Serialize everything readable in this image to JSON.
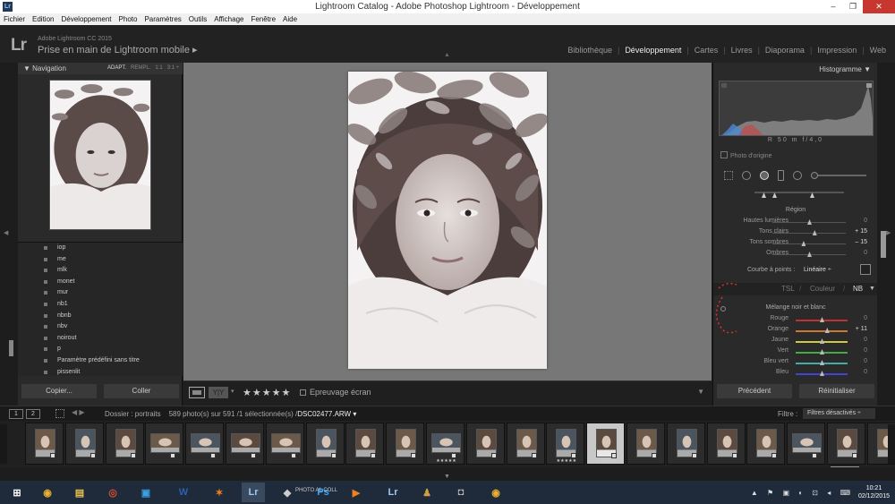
{
  "window": {
    "title": "Lightroom Catalog - Adobe Photoshop Lightroom - Développement",
    "app_icon": "Lr",
    "controls": [
      "–",
      "❐",
      "✕"
    ]
  },
  "menu": [
    "Fichier",
    "Edition",
    "Développement",
    "Photo",
    "Paramètres",
    "Outils",
    "Affichage",
    "Fenêtre",
    "Aide"
  ],
  "identity": {
    "logo": "Lr",
    "subtitle": "Adobe Lightroom CC 2015",
    "title": "Prise en main de Lightroom mobile",
    "title_arrow": "▸"
  },
  "modules": [
    {
      "label": "Bibliothèque",
      "active": false
    },
    {
      "label": "Développement",
      "active": true
    },
    {
      "label": "Cartes",
      "active": false
    },
    {
      "label": "Livres",
      "active": false
    },
    {
      "label": "Diaporama",
      "active": false
    },
    {
      "label": "Impression",
      "active": false
    },
    {
      "label": "Web",
      "active": false
    }
  ],
  "navigator": {
    "title": "Navigation",
    "modes": [
      "ADAPT.",
      "REMPL.",
      "1:1",
      "3:1 ÷"
    ]
  },
  "presets": [
    "iop",
    "me",
    "mlk",
    "monet",
    "mur",
    "nb1",
    "nbnb",
    "nbv",
    "noirout",
    "p",
    "Paramètre prédéfini sans titre",
    "pissenlit"
  ],
  "left_buttons": {
    "copy": "Copier...",
    "paste": "Coller"
  },
  "toolbar": {
    "yy": "Y|Y",
    "stars": "★★★★★",
    "softproof": "Epreuvage écran"
  },
  "histogram": {
    "title": "Histogramme",
    "info": "R 50 m f/4,0",
    "original": "Photo d'origine",
    "colors": {
      "blue": "#4a8ad6",
      "red": "#d04040",
      "gray": "#9a9a9a"
    }
  },
  "region": {
    "title": "Région",
    "sliders": [
      {
        "label": "Hautes lumières",
        "value": "0",
        "pos": 0.5
      },
      {
        "label": "Tons clairs",
        "value": "+ 15",
        "pos": 0.57
      },
      {
        "label": "Tons sombres",
        "value": "– 15",
        "pos": 0.42
      },
      {
        "label": "Ombres",
        "value": "0",
        "pos": 0.5
      }
    ]
  },
  "curve": {
    "label": "Courbe à points :",
    "value": "Linéaire ÷"
  },
  "hsl": {
    "tsl": "TSL",
    "sep1": "/",
    "couleur": "Couleur",
    "sep2": "/",
    "nb": "NB",
    "arrow": "▼"
  },
  "bw_mix": {
    "title": "Mélange noir et blanc",
    "sliders": [
      {
        "label": "Rouge",
        "value": "0",
        "pos": 0.5,
        "color": "#b33"
      },
      {
        "label": "Orange",
        "value": "+ 11",
        "pos": 0.6,
        "color": "#c73"
      },
      {
        "label": "Jaune",
        "value": "0",
        "pos": 0.5,
        "color": "#cc4"
      },
      {
        "label": "Vert",
        "value": "0",
        "pos": 0.5,
        "color": "#4a4"
      },
      {
        "label": "Bleu vert",
        "value": "0",
        "pos": 0.5,
        "color": "#4aa"
      },
      {
        "label": "Bleu",
        "value": "0",
        "pos": 0.5,
        "color": "#44c"
      }
    ]
  },
  "right_buttons": {
    "previous": "Précédent",
    "reset": "Réinitialiser"
  },
  "filmbar": {
    "pages": [
      "1",
      "2"
    ],
    "nav": "◀ ▶",
    "source_prefix": "Dossier : portraits",
    "count": "589 photo(s) sur 591 /1 sélectionnée(s) /",
    "file": "DSC02477.ARW ▾",
    "filter_label": "Filtre :",
    "filter_value": "Filtres désactivés ÷"
  },
  "filmstrip": [
    {
      "orient": "p",
      "sel": false,
      "stars": ""
    },
    {
      "orient": "p",
      "sel": false,
      "stars": ""
    },
    {
      "orient": "p",
      "sel": false,
      "stars": ""
    },
    {
      "orient": "l",
      "sel": false,
      "stars": ""
    },
    {
      "orient": "l",
      "sel": false,
      "stars": ""
    },
    {
      "orient": "l",
      "sel": false,
      "stars": ""
    },
    {
      "orient": "l",
      "sel": false,
      "stars": ""
    },
    {
      "orient": "p",
      "sel": false,
      "stars": ""
    },
    {
      "orient": "p",
      "sel": false,
      "stars": ""
    },
    {
      "orient": "p",
      "sel": false,
      "stars": ""
    },
    {
      "orient": "l",
      "sel": false,
      "stars": "★★★★★"
    },
    {
      "orient": "p",
      "sel": false,
      "stars": ""
    },
    {
      "orient": "p",
      "sel": false,
      "stars": ""
    },
    {
      "orient": "p",
      "sel": false,
      "stars": "★★★★★"
    },
    {
      "orient": "p",
      "sel": true,
      "stars": "★★★★★"
    },
    {
      "orient": "p",
      "sel": false,
      "stars": ""
    },
    {
      "orient": "p",
      "sel": false,
      "stars": ""
    },
    {
      "orient": "p",
      "sel": false,
      "stars": ""
    },
    {
      "orient": "p",
      "sel": false,
      "stars": ""
    },
    {
      "orient": "l",
      "sel": false,
      "stars": ""
    },
    {
      "orient": "p",
      "sel": false,
      "stars": ""
    },
    {
      "orient": "p",
      "sel": false,
      "stars": ""
    }
  ],
  "taskbar": {
    "items": [
      {
        "name": "windows-start-icon",
        "glyph": "⊞",
        "color": "#ffffff"
      },
      {
        "name": "chrome-icon",
        "glyph": "◉",
        "color": "#e8b030"
      },
      {
        "name": "file-explorer-icon",
        "glyph": "▤",
        "color": "#e8c050"
      },
      {
        "name": "eye-app-icon",
        "glyph": "◎",
        "color": "#d85030"
      },
      {
        "name": "app-icon",
        "glyph": "▣",
        "color": "#3aa0e0"
      },
      {
        "name": "word-icon",
        "glyph": "W",
        "color": "#2b5fb0"
      },
      {
        "name": "paint-icon",
        "glyph": "✶",
        "color": "#f08020"
      },
      {
        "name": "lightroom-icon",
        "glyph": "Lr",
        "color": "#9ec6f0"
      },
      {
        "name": "photo-app-icon",
        "glyph": "◆",
        "color": "#cccccc"
      },
      {
        "name": "photoshop-icon",
        "glyph": "Ps",
        "color": "#31a8ff"
      },
      {
        "name": "media-app-icon",
        "glyph": "▶",
        "color": "#f08020"
      },
      {
        "name": "lightroom-icon-2",
        "glyph": "Lr",
        "color": "#9ec6f0"
      },
      {
        "name": "character-icon",
        "glyph": "♟",
        "color": "#d0a040"
      },
      {
        "name": "camera-icon",
        "glyph": "◘",
        "color": "#bbbbbb"
      },
      {
        "name": "chrome-icon-2",
        "glyph": "◉",
        "color": "#e8b030"
      }
    ],
    "overlay_text": "PHOTO AL COLL",
    "systray": "▲ ⚑ ▣ ◐ ⊡ ◂ ⌨",
    "time": "10:21",
    "date": "02/12/2015"
  }
}
